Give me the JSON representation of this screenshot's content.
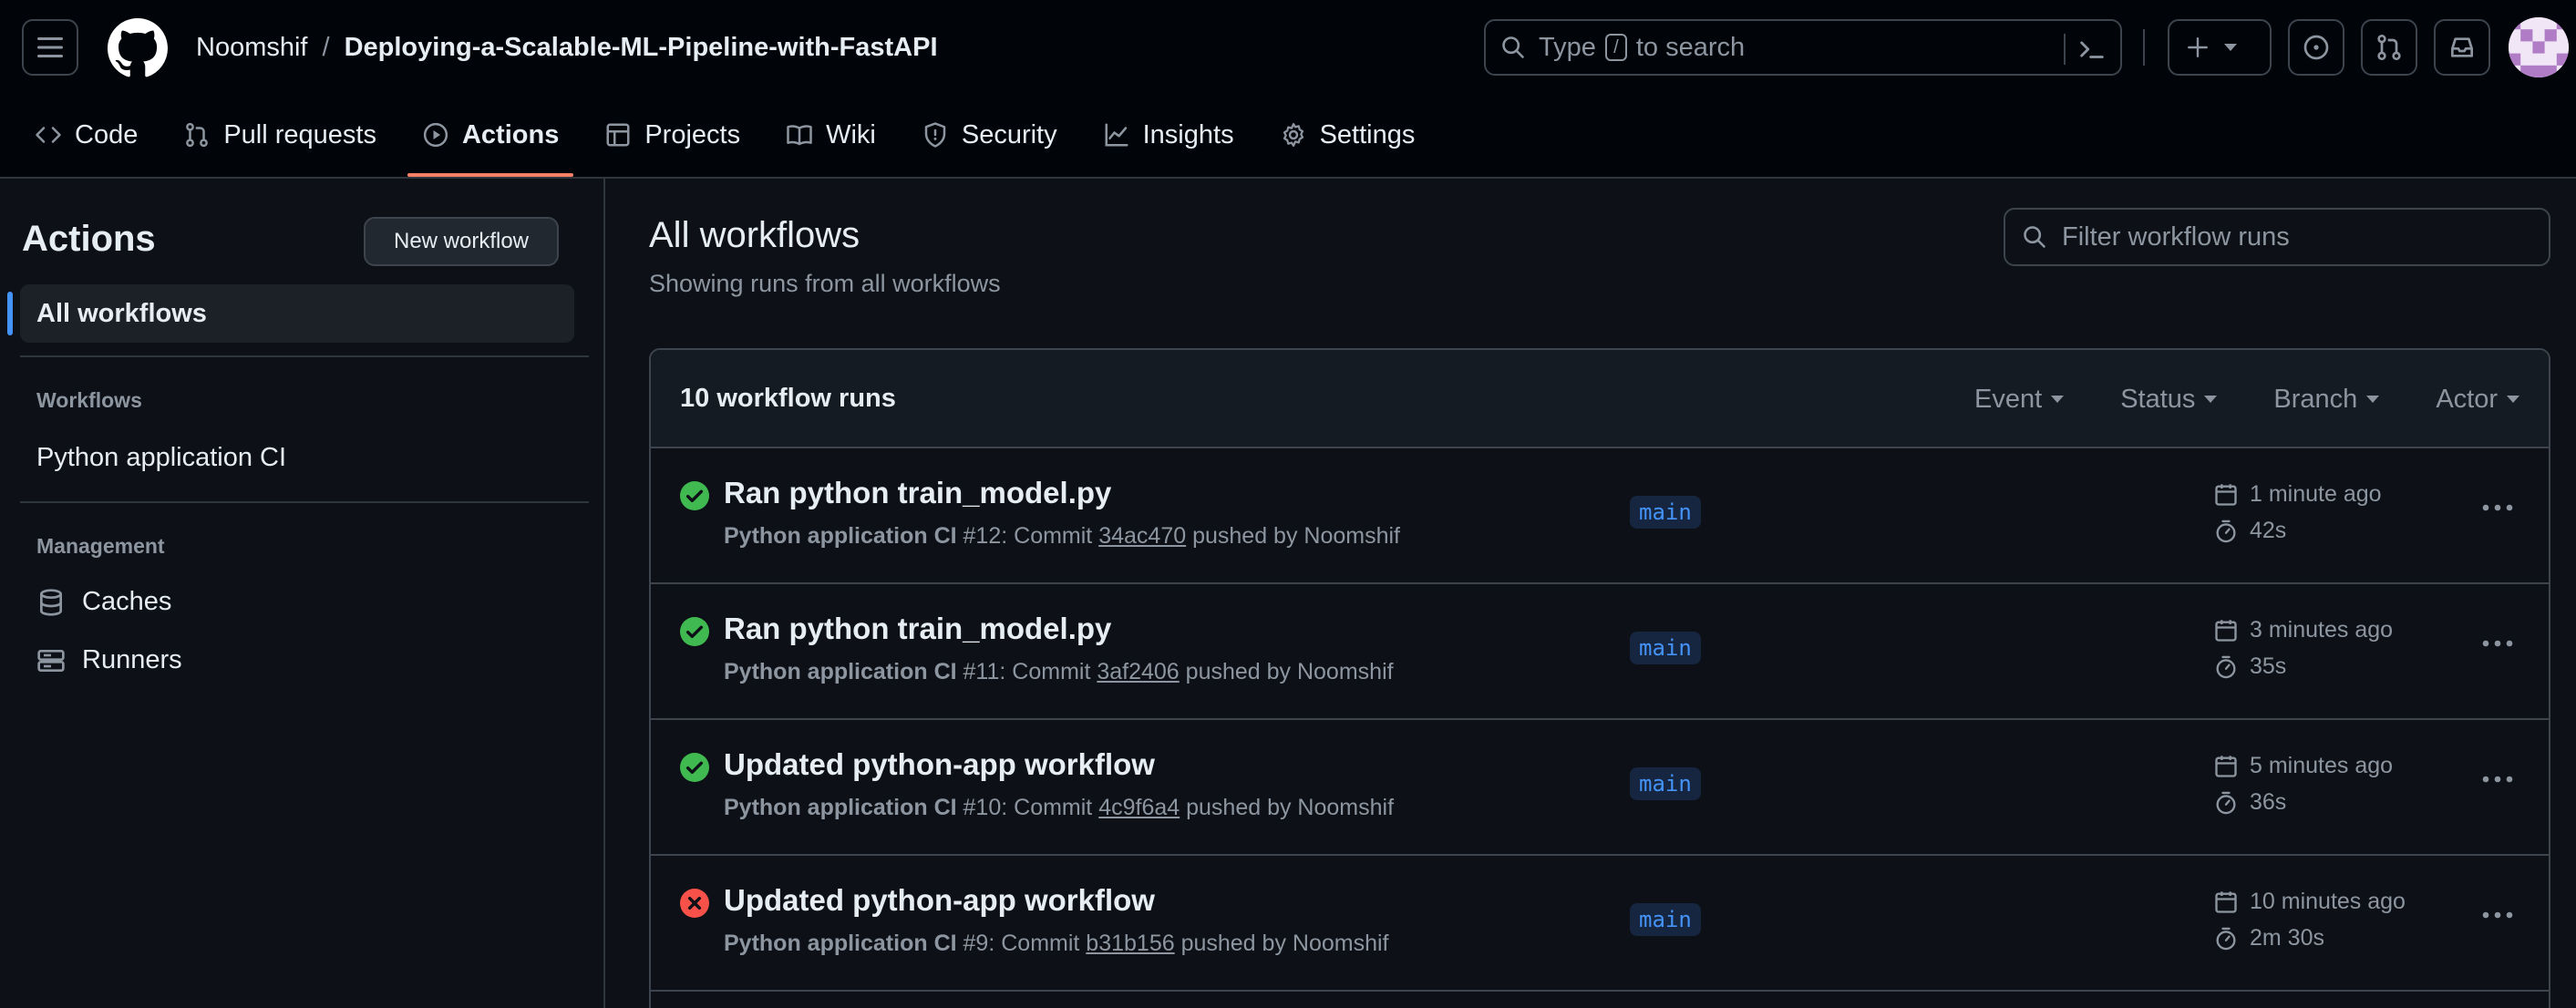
{
  "header": {
    "owner": "Noomshif",
    "separator": "/",
    "repo": "Deploying-a-Scalable-ML-Pipeline-with-FastAPI",
    "search_prefix": "Type",
    "search_key": "/",
    "search_suffix": "to search"
  },
  "tabs": [
    {
      "label": "Code",
      "icon": "code-icon"
    },
    {
      "label": "Pull requests",
      "icon": "git-pull-request-icon"
    },
    {
      "label": "Actions",
      "icon": "play-icon",
      "active": true
    },
    {
      "label": "Projects",
      "icon": "table-icon"
    },
    {
      "label": "Wiki",
      "icon": "book-icon"
    },
    {
      "label": "Security",
      "icon": "shield-icon"
    },
    {
      "label": "Insights",
      "icon": "graph-icon"
    },
    {
      "label": "Settings",
      "icon": "gear-icon"
    }
  ],
  "sidebar": {
    "title": "Actions",
    "new_workflow": "New workflow",
    "all_workflows": "All workflows",
    "workflows_heading": "Workflows",
    "workflow_item": "Python application CI",
    "management_heading": "Management",
    "caches": "Caches",
    "runners": "Runners"
  },
  "main": {
    "title": "All workflows",
    "subtitle": "Showing runs from all workflows",
    "filter_placeholder": "Filter workflow runs",
    "runs_count": "10 workflow runs",
    "filters": [
      "Event",
      "Status",
      "Branch",
      "Actor"
    ]
  },
  "runs": [
    {
      "title": "Ran python train_model.py",
      "workflow": "Python application CI",
      "num": "#12",
      "commit_prefix": ": Commit ",
      "sha": "34ac470",
      "pushed": " pushed by Noomshif",
      "branch": "main",
      "time": "1 minute ago",
      "duration": "42s",
      "status": "success"
    },
    {
      "title": "Ran python train_model.py",
      "workflow": "Python application CI",
      "num": "#11",
      "commit_prefix": ": Commit ",
      "sha": "3af2406",
      "pushed": " pushed by Noomshif",
      "branch": "main",
      "time": "3 minutes ago",
      "duration": "35s",
      "status": "success"
    },
    {
      "title": "Updated python-app workflow",
      "workflow": "Python application CI",
      "num": "#10",
      "commit_prefix": ": Commit ",
      "sha": "4c9f6a4",
      "pushed": " pushed by Noomshif",
      "branch": "main",
      "time": "5 minutes ago",
      "duration": "36s",
      "status": "success"
    },
    {
      "title": "Updated python-app workflow",
      "workflow": "Python application CI",
      "num": "#9",
      "commit_prefix": ": Commit ",
      "sha": "b31b156",
      "pushed": " pushed by Noomshif",
      "branch": "main",
      "time": "10 minutes ago",
      "duration": "2m 30s",
      "status": "failure"
    }
  ],
  "colors": {
    "success": "#3fb950",
    "failure": "#f85149",
    "accent": "#f78166",
    "link": "#4493f8"
  }
}
